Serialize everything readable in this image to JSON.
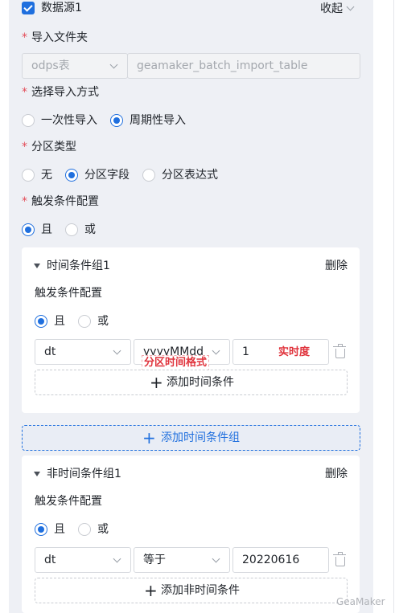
{
  "datasource": {
    "title": "数据源1",
    "collapse_label": "收起"
  },
  "import_folder": {
    "label": "导入文件夹",
    "source_type": "odps表",
    "table_placeholder": "geamaker_batch_import_table"
  },
  "import_mode": {
    "label": "选择导入方式",
    "options": [
      "一次性导入",
      "周期性导入"
    ],
    "selected": "周期性导入"
  },
  "partition_type": {
    "label": "分区类型",
    "options": [
      "无",
      "分区字段",
      "分区表达式"
    ],
    "selected": "分区字段"
  },
  "trigger": {
    "label": "触发条件配置",
    "options": [
      "且",
      "或"
    ],
    "selected": "且"
  },
  "time_group": {
    "title": "时间条件组1",
    "delete_label": "删除",
    "trigger_label": "触发条件配置",
    "logic_options": [
      "且",
      "或"
    ],
    "field": "dt",
    "format": "yyyyMMdd",
    "value": "1",
    "annotation_format": "分区时间格式",
    "annotation_timeliness": "实时度",
    "add_label": "添加时间条件"
  },
  "add_time_group_label": "添加时间条件组",
  "nontime_group": {
    "title": "非时间条件组1",
    "delete_label": "删除",
    "trigger_label": "触发条件配置",
    "logic_options": [
      "且",
      "或"
    ],
    "field": "dt",
    "operator": "等于",
    "value": "20220616",
    "add_label": "添加非时间条件"
  },
  "watermark": "GeaMaker",
  "colors": {
    "accent": "#1f6fde",
    "required": "#e34d59",
    "annotation": "#e0343d"
  },
  "icons": [
    "checkbox-checked-icon",
    "chevron-down-icon",
    "caret-down-icon",
    "trash-icon",
    "plus-icon"
  ]
}
